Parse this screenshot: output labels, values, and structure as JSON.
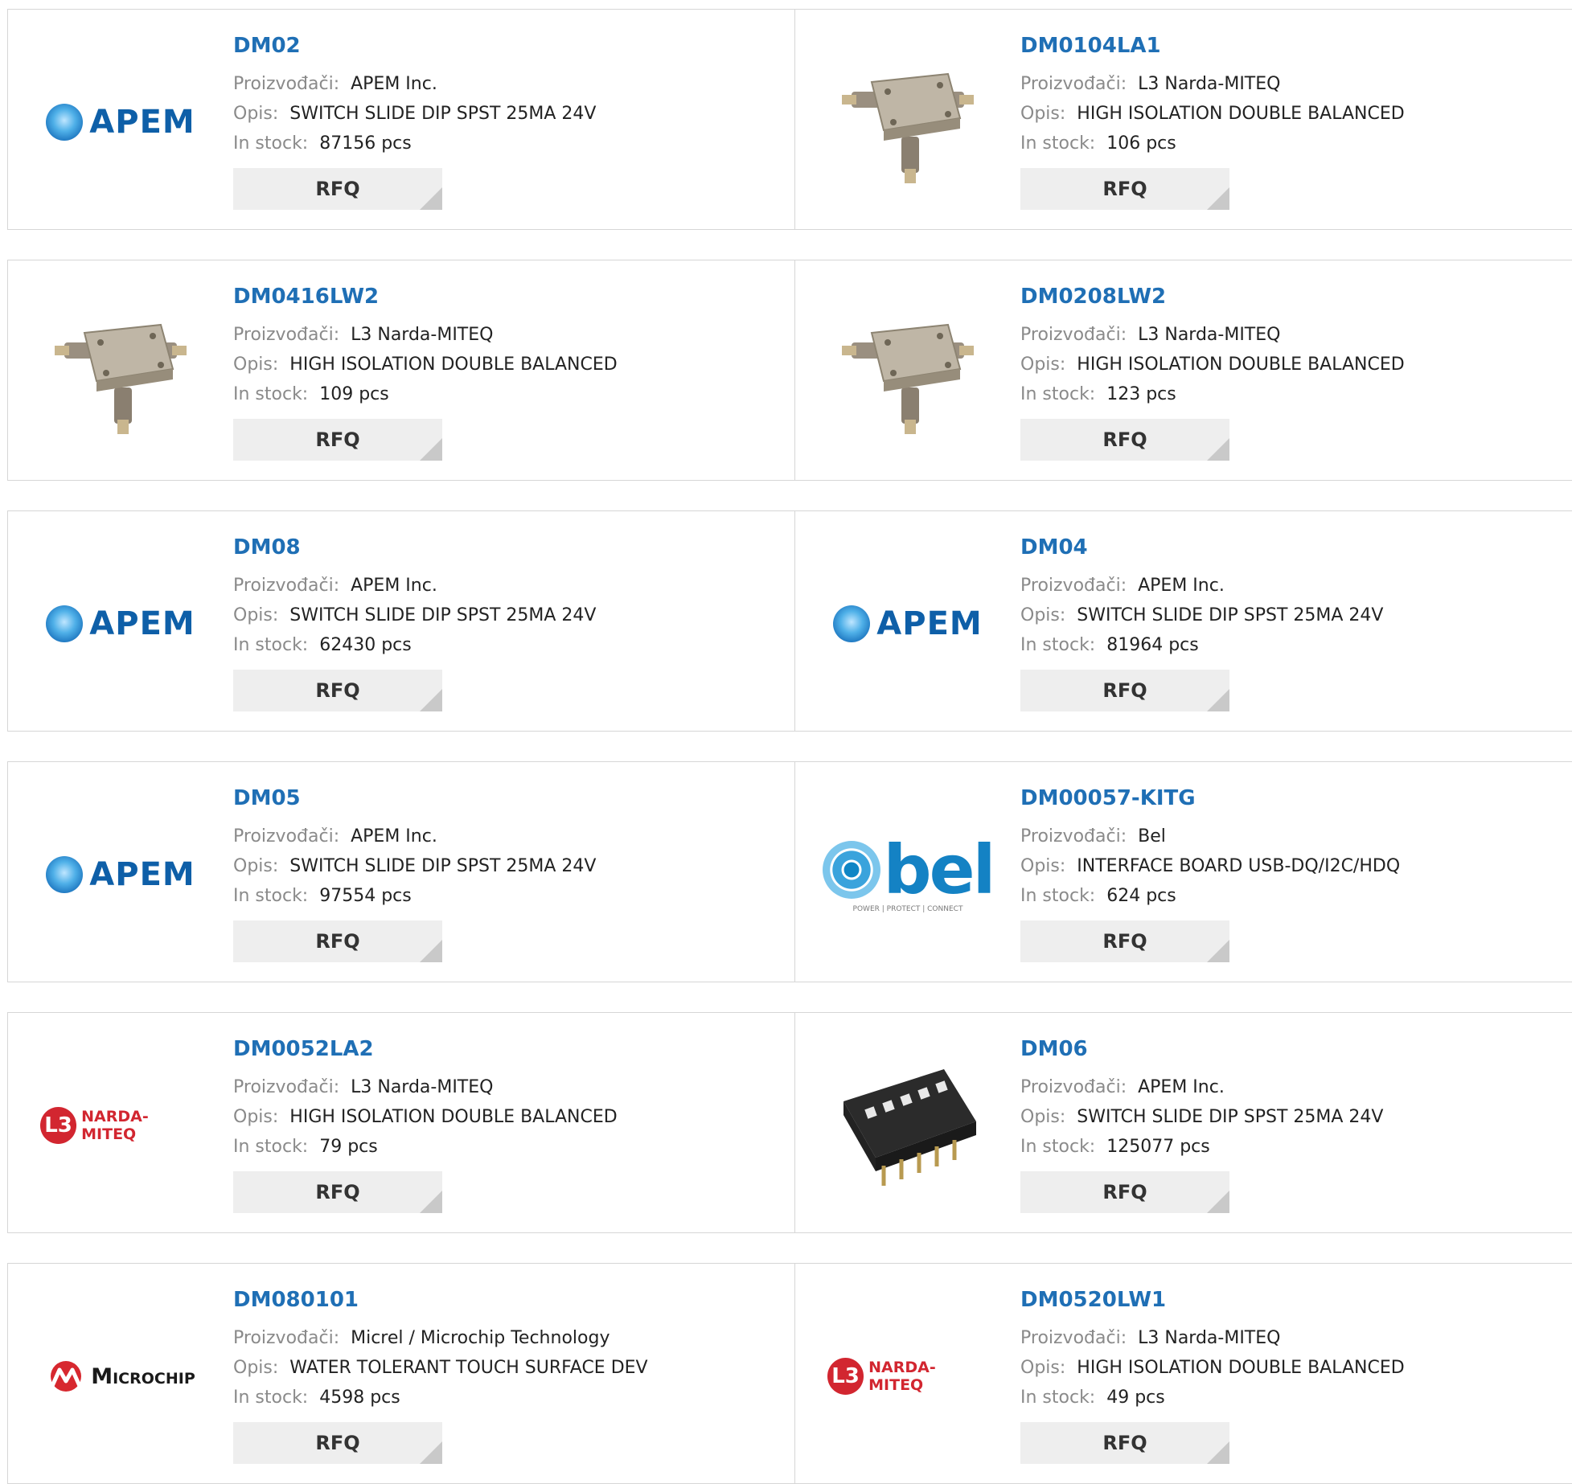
{
  "labels": {
    "manufacturer": "Proizvođači:",
    "description": "Opis:",
    "stock": "In stock:",
    "rfq": "RFQ"
  },
  "products": [
    {
      "part": "DM02",
      "manufacturer": "APEM Inc.",
      "description": "SWITCH SLIDE DIP SPST 25MA 24V",
      "stock": "87156 pcs",
      "image": "apem-logo",
      "logo_text": "APEM"
    },
    {
      "part": "DM0104LA1",
      "manufacturer": "L3 Narda-MITEQ",
      "description": "HIGH ISOLATION DOUBLE BALANCED",
      "stock": "106 pcs",
      "image": "rf-mixer-photo"
    },
    {
      "part": "DM0416LW2",
      "manufacturer": "L3 Narda-MITEQ",
      "description": "HIGH ISOLATION DOUBLE BALANCED",
      "stock": "109 pcs",
      "image": "rf-mixer-photo"
    },
    {
      "part": "DM0208LW2",
      "manufacturer": "L3 Narda-MITEQ",
      "description": "HIGH ISOLATION DOUBLE BALANCED",
      "stock": "123 pcs",
      "image": "rf-mixer-photo"
    },
    {
      "part": "DM08",
      "manufacturer": "APEM Inc.",
      "description": "SWITCH SLIDE DIP SPST 25MA 24V",
      "stock": "62430 pcs",
      "image": "apem-logo",
      "logo_text": "APEM"
    },
    {
      "part": "DM04",
      "manufacturer": "APEM Inc.",
      "description": "SWITCH SLIDE DIP SPST 25MA 24V",
      "stock": "81964 pcs",
      "image": "apem-logo",
      "logo_text": "APEM"
    },
    {
      "part": "DM05",
      "manufacturer": "APEM Inc.",
      "description": "SWITCH SLIDE DIP SPST 25MA 24V",
      "stock": "97554 pcs",
      "image": "apem-logo",
      "logo_text": "APEM"
    },
    {
      "part": "DM00057-KITG",
      "manufacturer": "Bel",
      "description": "INTERFACE BOARD USB-DQ/I2C/HDQ",
      "stock": "624 pcs",
      "image": "bel-logo",
      "logo_text": "bel",
      "logo_tagline": "POWER | PROTECT | CONNECT"
    },
    {
      "part": "DM0052LA2",
      "manufacturer": "L3 Narda-MITEQ",
      "description": "HIGH ISOLATION DOUBLE BALANCED",
      "stock": "79 pcs",
      "image": "l3-narda-logo",
      "logo_badge": "L3",
      "logo_text": "NARDA-MITEQ"
    },
    {
      "part": "DM06",
      "manufacturer": "APEM Inc.",
      "description": "SWITCH SLIDE DIP SPST 25MA 24V",
      "stock": "125077 pcs",
      "image": "dip-switch-photo"
    },
    {
      "part": "DM080101",
      "manufacturer": "Micrel / Microchip Technology",
      "description": "WATER TOLERANT TOUCH SURFACE DEV",
      "stock": "4598 pcs",
      "image": "microchip-logo",
      "logo_text": "Microchip"
    },
    {
      "part": "DM0520LW1",
      "manufacturer": "L3 Narda-MITEQ",
      "description": "HIGH ISOLATION DOUBLE BALANCED",
      "stock": "49 pcs",
      "image": "l3-narda-logo",
      "logo_badge": "L3",
      "logo_text": "NARDA-MITEQ"
    }
  ],
  "colors": {
    "part_link": "#1f6fb5",
    "label": "#8a8a8a",
    "border": "#d6d6d6",
    "rfq_bg": "#eeeeee",
    "apem_blue": "#0e5fa8",
    "bel_blue": "#1482c4",
    "l3_red": "#d22630"
  }
}
